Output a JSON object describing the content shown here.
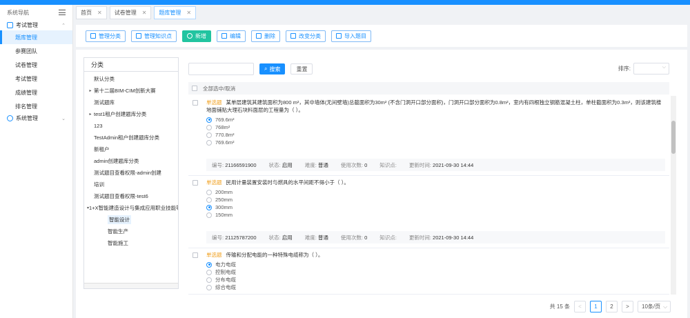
{
  "sidebar": {
    "title": "系统导航",
    "groups": [
      {
        "label": "考试管理",
        "items": [
          "题库管理",
          "参赛团队",
          "试卷管理",
          "考试管理",
          "成绩管理",
          "排名管理"
        ]
      },
      {
        "label": "系统管理",
        "items": []
      }
    ],
    "active_item": "题库管理"
  },
  "tabs": [
    {
      "label": "首页"
    },
    {
      "label": "试卷管理"
    },
    {
      "label": "题库管理"
    }
  ],
  "toolbar": {
    "buttons": [
      "管理分类",
      "管理知识点",
      "新增",
      "编辑",
      "删除",
      "改变分类",
      "导入题目"
    ]
  },
  "tree": {
    "title": "分类",
    "nodes": [
      {
        "label": "默认分类",
        "caret": ""
      },
      {
        "label": "第十二届BIM-CIM创新大赛",
        "caret": "▸"
      },
      {
        "label": "测试题库",
        "caret": ""
      },
      {
        "label": "test1租户创建题库分类",
        "caret": "▸"
      },
      {
        "label": "123",
        "caret": ""
      },
      {
        "label": "TestAdmin租户创建题库分类",
        "caret": ""
      },
      {
        "label": "新租户",
        "caret": ""
      },
      {
        "label": "admin创建题库分类",
        "caret": ""
      },
      {
        "label": "测试题目查看权限-admin创建",
        "caret": ""
      },
      {
        "label": "培训",
        "caret": ""
      },
      {
        "label": "测试题目查看权限-test6",
        "caret": ""
      },
      {
        "label": "1+X智能建造设计与集成应用职业技能等",
        "caret": "▾"
      },
      {
        "label": "智能设计",
        "caret": "",
        "child": true,
        "selected": true
      },
      {
        "label": "智能生产",
        "caret": "",
        "child": true
      },
      {
        "label": "智能施工",
        "caret": "",
        "child": true
      }
    ]
  },
  "search": {
    "button_label": "搜索",
    "reset_label": "重置",
    "sort_label": "排序:"
  },
  "select_all_label": "全部选中/取消",
  "questions": [
    {
      "type": "单选题",
      "text": "某单层建筑其建筑面积为800 m²，其中墙体(无间壁墙)总截面积为30m² (不含门洞开口部分面积)，门洞开口部分面积为0.8m²，室内有四根独立钢筋混凝土柱，单柱截面积为0.3m²，则该建筑楼地面铺贴大理石块料面层的工程量为（ ）。",
      "options": [
        "769.6m²",
        "768m²",
        "770.8m²",
        "769.6m²"
      ],
      "selected": 0,
      "meta": {
        "id_label": "编号:",
        "id": "21166591900",
        "status_label": "状态:",
        "status": "启用",
        "difficulty_label": "难度:",
        "difficulty": "普通",
        "uses_label": "使用次数:",
        "uses": "0",
        "knowledge_label": "知识点:",
        "knowledge": "",
        "updated_label": "更新时间:",
        "updated": "2021-09-30 14:44"
      }
    },
    {
      "type": "单选题",
      "text": "民用计量装置安装时与燃具的水平间距不得小于（ ）。",
      "options": [
        "200mm",
        "250mm",
        "300mm",
        "150mm"
      ],
      "selected": 2,
      "meta": {
        "id_label": "编号:",
        "id": "21125787200",
        "status_label": "状态:",
        "status": "启用",
        "difficulty_label": "难度:",
        "difficulty": "普通",
        "uses_label": "使用次数:",
        "uses": "0",
        "knowledge_label": "知识点:",
        "knowledge": "",
        "updated_label": "更新时间:",
        "updated": "2021-09-30 14:44"
      }
    },
    {
      "type": "单选题",
      "text": "传输和分配电能的一种特殊电缆称为（ ）。",
      "options": [
        "电力电缆",
        "控制电缆",
        "分布电缆",
        "综合电缆"
      ],
      "selected": 0,
      "meta": null
    }
  ],
  "pagination": {
    "total_text": "共 15 条",
    "prev": "<",
    "pages": [
      "1",
      "2"
    ],
    "current": "1",
    "next": ">",
    "page_size": "10条/页"
  },
  "colors": {
    "accent": "#1890ff",
    "add_button": "#21c4a0",
    "question_tag": "#f0a020"
  }
}
